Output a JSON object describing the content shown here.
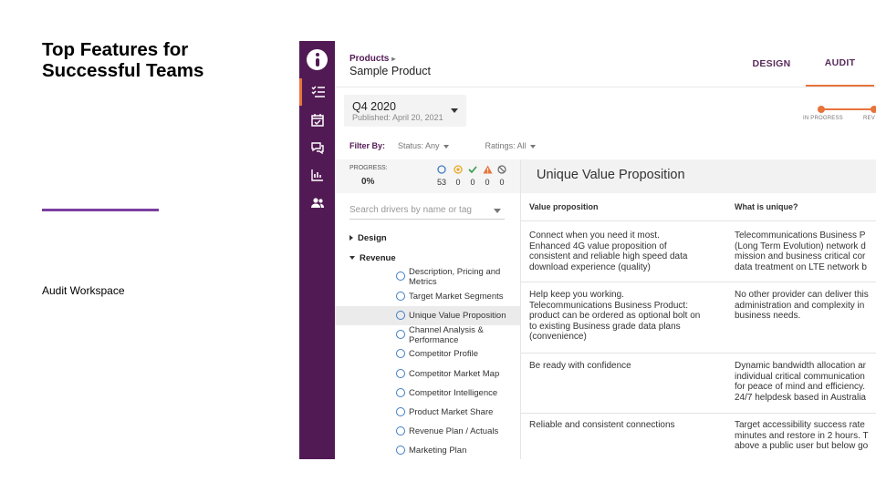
{
  "slide": {
    "title": "Top Features for Successful Teams",
    "subtitle": "Audit Workspace",
    "accent": "#7b3fa0"
  },
  "app": {
    "brand_color": "#521a54",
    "accent_color": "#e8743b",
    "rail_icons": [
      "checklist-icon",
      "calendar-check-icon",
      "chat-icon",
      "bar-chart-icon",
      "users-icon"
    ],
    "breadcrumb": "Products",
    "product_title": "Sample Product",
    "tabs": [
      {
        "label": "DESIGN",
        "active": false
      },
      {
        "label": "AUDIT",
        "active": true
      }
    ],
    "period": {
      "name": "Q4 2020",
      "published": "Published: April 20, 2021"
    },
    "steps": [
      "IN PROGRESS",
      "REV"
    ],
    "filter": {
      "label": "Filter By:",
      "status": "Status: Any",
      "ratings": "Ratings: All"
    },
    "progress": {
      "label": "PROGRESS:",
      "value": "0%",
      "stats": [
        {
          "icon": "not-started-icon",
          "count": "53"
        },
        {
          "icon": "in-progress-icon",
          "count": "0"
        },
        {
          "icon": "complete-icon",
          "count": "0"
        },
        {
          "icon": "warning-icon",
          "count": "0"
        },
        {
          "icon": "blocked-icon",
          "count": "0"
        }
      ]
    },
    "search_placeholder": "Search drivers by name or tag",
    "tree": {
      "groups": [
        "Design",
        "Revenue"
      ],
      "items": [
        "Description, Pricing and Metrics",
        "Target Market Segments",
        "Unique Value Proposition",
        "Channel Analysis & Performance",
        "Competitor Profile",
        "Competitor Market Map",
        "Competitor Intelligence",
        "Product Market Share",
        "Revenue Plan / Actuals",
        "Marketing Plan"
      ],
      "selected_index": 2
    },
    "content": {
      "title": "Unique Value Proposition",
      "columns": [
        "Value proposition",
        "What is unique?"
      ],
      "rows": [
        {
          "c1": [
            "Connect when you need it most.",
            "Enhanced 4G value proposition of",
            "consistent and reliable high speed data",
            "download experience (quality)"
          ],
          "c2": [
            "Telecommunications Business P",
            "(Long Term Evolution) network d",
            "mission and business critical cor",
            "data treatment on LTE network b"
          ]
        },
        {
          "c1": [
            "Help keep you working.",
            "Telecommunications Business Product:",
            "product can be ordered as optional bolt on",
            "to existing Business grade data plans",
            "(convenience)"
          ],
          "c2": [
            "No other provider can deliver this",
            "administration and complexity in",
            "business needs."
          ]
        },
        {
          "c1": [
            "Be ready with confidence"
          ],
          "c2": [
            "Dynamic bandwidth allocation ar",
            "individual critical communication",
            "for peace of mind and efficiency.",
            "24/7 helpdesk based in Australia"
          ]
        },
        {
          "c1": [
            "Reliable and consistent connections"
          ],
          "c2": [
            "Target accessibility success rate",
            "minutes and restore in 2 hours. T",
            "above a public user but below go"
          ]
        }
      ]
    }
  }
}
